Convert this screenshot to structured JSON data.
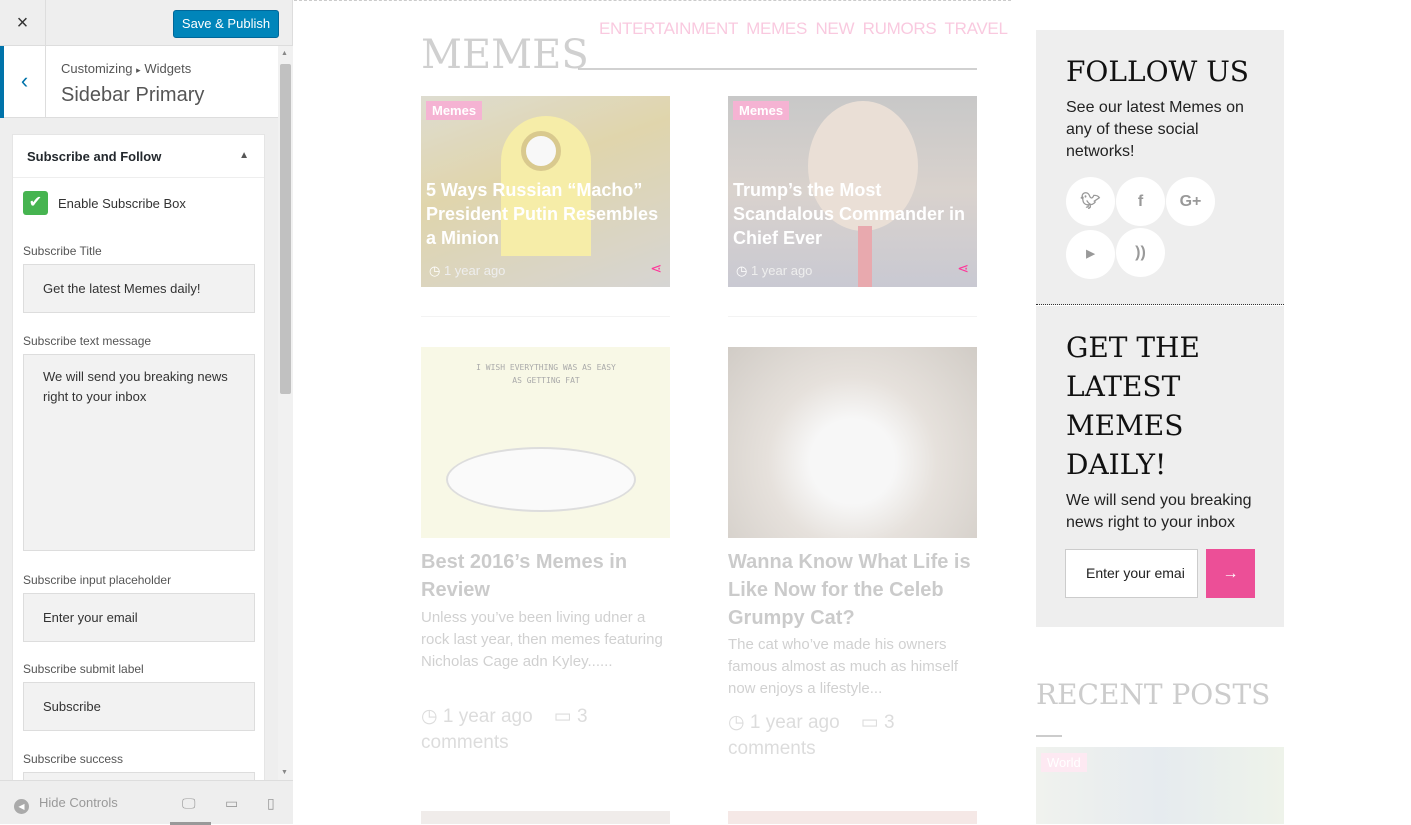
{
  "customizer": {
    "close_icon": "×",
    "save_label": "Save & Publish",
    "breadcrumb": {
      "root": "Customizing",
      "sep": "▸",
      "current": "Widgets"
    },
    "section_title": "Sidebar Primary",
    "widget": {
      "title": "Subscribe and Follow",
      "enable_label": "Enable Subscribe Box",
      "enabled": true,
      "fields": [
        {
          "label": "Subscribe Title",
          "value": "Get the latest Memes daily!"
        },
        {
          "label": "Subscribe text message",
          "value": "We will send you breaking news right to your inbox"
        },
        {
          "label": "Subscribe input placeholder",
          "value": "Enter your email"
        },
        {
          "label": "Subscribe submit label",
          "value": "Subscribe"
        },
        {
          "label": "Subscribe success",
          "value": ""
        }
      ]
    },
    "hide_controls": "Hide Controls",
    "devices": [
      "desktop",
      "tablet",
      "mobile"
    ],
    "active_device": "desktop"
  },
  "preview": {
    "nav": [
      "ENTERTAINMENT",
      "MEMES",
      "NEW",
      "RUMORS",
      "TRAVEL"
    ],
    "section_title": "MEMES",
    "featured": [
      {
        "tag": "Memes",
        "title": "5 Ways Russian “Macho” President Putin Resembles a Minion",
        "time": "1 year ago"
      },
      {
        "tag": "Memes",
        "title": "Trump’s the Most Scandalous Commander in Chief Ever",
        "time": "1 year ago"
      }
    ],
    "posts": [
      {
        "image_text": "I WISH EVERYTHING WAS AS EASY AS GETTING FAT",
        "title": "Best 2016’s Memes in Review",
        "excerpt": "Unless you’ve been living udner a rock last year, then memes featuring Nicholas Cage adn Kyley......",
        "time": "1 year ago",
        "comments": "3 comments"
      },
      {
        "title": "Wanna Know What Life is Like Now for the Celeb Grumpy Cat?",
        "excerpt": "The cat who’ve made his owners famous almost as much as himself now enjoys a lifestyle...",
        "time": "1 year ago",
        "comments": "3 comments"
      }
    ],
    "follow": {
      "title": "FOLLOW US",
      "text": "See our latest Memes on any of these social networks!",
      "networks": [
        "twitter",
        "facebook",
        "google-plus",
        "youtube",
        "rss"
      ]
    },
    "subscribe": {
      "title": "GET THE LATEST MEMES DAILY!",
      "text": "We will send you breaking news right to your inbox",
      "placeholder": "Enter your emai"
    },
    "recent": {
      "title": "RECENT POSTS",
      "tag": "World"
    },
    "accent": "#ec4f97"
  }
}
